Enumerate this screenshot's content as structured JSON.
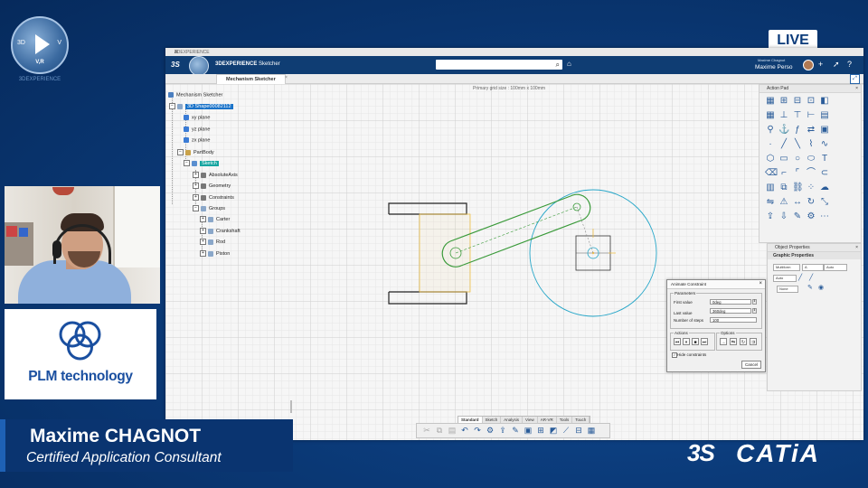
{
  "overlay": {
    "live_label": "LIVE",
    "logo_3d": {
      "left": "3D",
      "right": "V",
      "bottom": "V,R",
      "caption": "3DEXPERIENCE"
    },
    "presenter_name": "Maxime CHAGNOT",
    "presenter_role": "Certified Application Consultant",
    "sponsor_text": "PLM technology",
    "brand_ds": "3S",
    "brand_name": "CATiA"
  },
  "app": {
    "window_title": "3DEXPERIENCE",
    "app_title_brand": "3DEXPERIENCE",
    "app_title_name": "Sketcher",
    "search_placeholder": "",
    "user_small": "Maxime Chagnot",
    "user_name": "Maxime Perso",
    "active_tab": "Mechanism Sketcher",
    "grid_info": "Primary grid size : 100mm x 100mm"
  },
  "tree": {
    "root": "Mechanism Sketcher",
    "shape": "3D Shape00082112",
    "planes": [
      "xy plane",
      "yz plane",
      "zx plane"
    ],
    "partbody": "PartBody",
    "sketch": "Sketch",
    "sketch_children": [
      "AbsoluteAxis",
      "Geometry",
      "Constraints"
    ],
    "group": "Groups",
    "group_children": [
      "Carter",
      "Crankshaft",
      "Rod",
      "Piston"
    ]
  },
  "panels": {
    "action_pad_title": "Action Pad",
    "object_props_title": "Object Properties",
    "graphic_props_title": "Graphic Properties",
    "gp_row1": [
      "Multiform",
      "A",
      "Auto"
    ],
    "gp_row2": [
      "Auto"
    ],
    "gp_row3": [
      "None"
    ]
  },
  "dialog": {
    "title": "Animate Constraint",
    "params_label": "Parameters",
    "first_value_label": "First value",
    "first_value": "0deg",
    "last_value_label": "Last value",
    "last_value": "360deg",
    "steps_label": "Number of steps",
    "steps": "100",
    "actions_label": "Actions",
    "options_label": "Options",
    "hide_constraints_label": "Hide constraints",
    "cancel_label": "Cancel"
  },
  "bottom_tabs": [
    "Standard",
    "Sketch",
    "Analysis",
    "View",
    "AR-VR",
    "Tools",
    "Touch"
  ],
  "colors": {
    "rod": "#3a9a3a",
    "circle": "#26a6c8",
    "piston": "#f0c24a",
    "ui_blue": "#0f3d73"
  }
}
